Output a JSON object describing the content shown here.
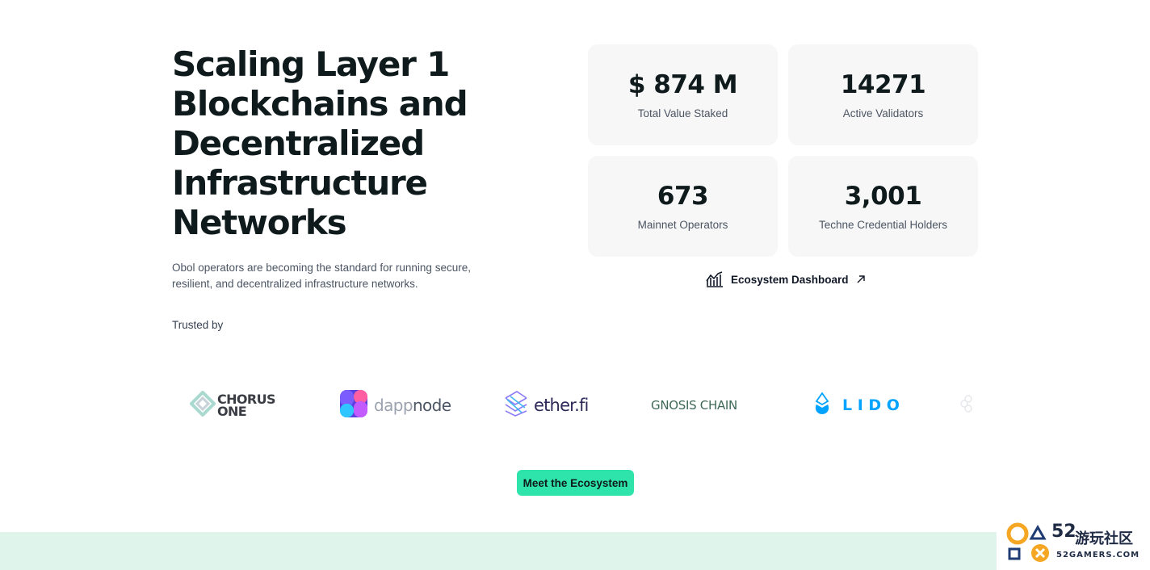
{
  "hero": {
    "title": "Scaling Layer 1 Blockchains and Decentralized Infrastructure Networks",
    "description": "Obol operators are becoming the standard for running secure, resilient, and decentralized infrastructure networks.",
    "trusted_by": "Trusted by"
  },
  "stats": [
    {
      "value": "$ 874 M",
      "label": "Total Value Staked"
    },
    {
      "value": "14271",
      "label": "Active Validators"
    },
    {
      "value": "673",
      "label": "Mainnet Operators"
    },
    {
      "value": "3,001",
      "label": "Techne Credential Holders"
    }
  ],
  "dashboard_link": {
    "label": "Ecosystem Dashboard",
    "icon": "chart-line-icon",
    "arrow_icon": "arrow-up-right-icon"
  },
  "partners": [
    {
      "line1": "CHORUS",
      "line2": "ONE",
      "icon": "chorus-one-logo",
      "color": "#2b2d33"
    },
    {
      "name_light": "dapp",
      "name_bold": "node",
      "icon": "dappnode-logo",
      "color": "#6b7280"
    },
    {
      "name": "ether.fi",
      "icon": "etherfi-logo",
      "color": "#2d2a5a"
    },
    {
      "name": "GNOSIS CHAIN",
      "icon": "gnosis-chain-logo",
      "color": "#3e6957"
    },
    {
      "name": "L I D O",
      "icon": "lido-logo",
      "color": "#00a3ff"
    }
  ],
  "cta": {
    "label": "Meet the Ecosystem"
  },
  "colors": {
    "accent": "#2fe4ab",
    "band": "#dff5ec",
    "card": "#f7f7f7"
  },
  "watermark": {
    "number": "52",
    "cn": "游玩社区",
    "site": "52GAMERS.COM"
  }
}
